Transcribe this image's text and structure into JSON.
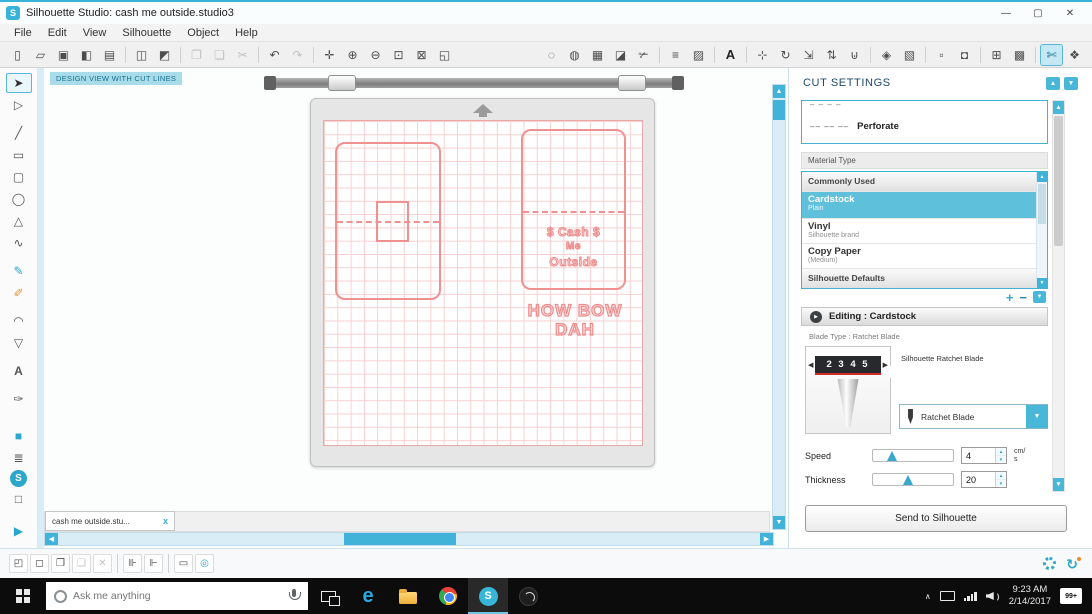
{
  "window": {
    "title": "Silhouette Studio: cash me outside.studio3",
    "app_icon_letter": "S",
    "minimize": "—",
    "maximize": "▢",
    "close": "✕"
  },
  "menu": [
    "File",
    "Edit",
    "View",
    "Silhouette",
    "Object",
    "Help"
  ],
  "icons": {
    "up": "▲",
    "down": "▼",
    "left": "◀",
    "right": "▶",
    "tiny_up": "▴",
    "tiny_down": "▾",
    "plus": "+",
    "minus": "−",
    "play": "▶",
    "chevron_up": "∧",
    "sync": "↻",
    "edge_letter": "e",
    "silhouette_letter": "S"
  },
  "toolbar_left": [
    {
      "name": "new-document-icon",
      "glyph": "▯"
    },
    {
      "name": "open-icon",
      "glyph": "▱"
    },
    {
      "name": "save-icon",
      "glyph": "▣"
    },
    {
      "name": "save-to-library-icon",
      "glyph": "◧"
    },
    {
      "name": "print-icon",
      "glyph": "▤"
    },
    {
      "name": "sep-1",
      "glyph": "",
      "state": "sep",
      "inter": "false"
    },
    {
      "name": "cut-preview-icon",
      "glyph": "◫"
    },
    {
      "name": "send-to-printer-icon",
      "glyph": "◩"
    },
    {
      "name": "sep-2",
      "glyph": "",
      "state": "sep",
      "inter": "false"
    },
    {
      "name": "copy-icon",
      "glyph": "❐",
      "state": "disabled"
    },
    {
      "name": "paste-icon",
      "glyph": "❏",
      "state": "disabled"
    },
    {
      "name": "cut-icon",
      "glyph": "✂",
      "state": "disabled"
    },
    {
      "name": "sep-3",
      "glyph": "",
      "state": "sep",
      "inter": "false"
    },
    {
      "name": "undo-icon",
      "glyph": "↶"
    },
    {
      "name": "redo-icon",
      "glyph": "↷",
      "state": "disabled"
    },
    {
      "name": "sep-4",
      "glyph": "",
      "state": "sep",
      "inter": "false"
    },
    {
      "name": "pan-icon",
      "glyph": "✛"
    },
    {
      "name": "zoom-in-icon",
      "glyph": "⊕"
    },
    {
      "name": "zoom-out-icon",
      "glyph": "⊖"
    },
    {
      "name": "zoom-selection-icon",
      "glyph": "⊡"
    },
    {
      "name": "drag-zoom-icon",
      "glyph": "⊠"
    },
    {
      "name": "fit-to-page-icon",
      "glyph": "◱"
    }
  ],
  "toolbar_right": [
    {
      "name": "lasso-select-icon",
      "glyph": "◌"
    },
    {
      "name": "select-by-color-icon",
      "glyph": "◍"
    },
    {
      "name": "table-icon",
      "glyph": "▦"
    },
    {
      "name": "eraser-icon",
      "glyph": "◪"
    },
    {
      "name": "knife-icon",
      "glyph": "✃"
    },
    {
      "name": "sep-5",
      "glyph": "",
      "state": "sep",
      "inter": "false"
    },
    {
      "name": "line-style-icon",
      "glyph": "≡"
    },
    {
      "name": "fill-style-icon",
      "glyph": "▨"
    },
    {
      "name": "sep-6",
      "glyph": "",
      "state": "sep",
      "inter": "false"
    },
    {
      "name": "text-style-icon",
      "glyph": "A"
    },
    {
      "name": "sep-7",
      "glyph": "",
      "state": "sep",
      "inter": "false"
    },
    {
      "name": "align-icon",
      "glyph": "⊹"
    },
    {
      "name": "rotate-icon",
      "glyph": "↻"
    },
    {
      "name": "scale-icon",
      "glyph": "⇲"
    },
    {
      "name": "spacing-icon",
      "glyph": "⇅"
    },
    {
      "name": "weld-icon",
      "glyph": "⊍"
    },
    {
      "name": "sep-8",
      "glyph": "",
      "state": "sep",
      "inter": "false"
    },
    {
      "name": "trace-icon",
      "glyph": "◈"
    },
    {
      "name": "image-effects-icon",
      "glyph": "▧"
    },
    {
      "name": "sep-9",
      "glyph": "",
      "state": "sep",
      "inter": "false"
    },
    {
      "name": "page-setup-icon",
      "glyph": "▫"
    },
    {
      "name": "registration-marks-icon",
      "glyph": "◘"
    },
    {
      "name": "sep-10",
      "glyph": "",
      "state": "sep",
      "inter": "false"
    },
    {
      "name": "grid-settings-icon",
      "glyph": "⊞"
    },
    {
      "name": "pixscan-icon",
      "glyph": "▩"
    },
    {
      "name": "sep-11",
      "glyph": "",
      "state": "sep",
      "inter": "false"
    },
    {
      "name": "cut-settings-icon",
      "glyph": "✄",
      "state": "active"
    },
    {
      "name": "cut-by-color-icon",
      "glyph": "❖"
    }
  ],
  "tools": [
    {
      "name": "select-tool",
      "glyph": "➤",
      "state": "active"
    },
    {
      "name": "point-editing-tool",
      "glyph": "▷"
    },
    {
      "name": "line-tool",
      "glyph": "╱",
      "gap": "1"
    },
    {
      "name": "rectangle-tool",
      "glyph": "▭"
    },
    {
      "name": "rounded-rectangle-tool",
      "glyph": "▢"
    },
    {
      "name": "ellipse-tool",
      "glyph": "◯"
    },
    {
      "name": "polygon-tool",
      "glyph": "△"
    },
    {
      "name": "curve-tool",
      "glyph": "∿"
    },
    {
      "name": "freehand-tool",
      "glyph": "✎",
      "color": "teal",
      "gap": "1"
    },
    {
      "name": "smooth-freehand-tool",
      "glyph": "✐",
      "color": "orange"
    },
    {
      "name": "arc-tool",
      "glyph": "◠",
      "gap": "1"
    },
    {
      "name": "regular-polygon-tool",
      "glyph": "▽"
    },
    {
      "name": "text-tool",
      "glyph": "A",
      "gap": "1"
    },
    {
      "name": "sticky-note-tool",
      "glyph": "✑",
      "gap": "1"
    },
    {
      "name": "fill-color-tool",
      "glyph": "■",
      "color": "teal",
      "gap": "2"
    },
    {
      "name": "library-icon",
      "glyph": "≣"
    },
    {
      "name": "store-icon",
      "glyph": "S",
      "color": "store"
    },
    {
      "name": "blank-swatch",
      "glyph": "□"
    },
    {
      "name": "expand-panel-icon",
      "glyph": "▶",
      "color": "teal",
      "gap": "3"
    }
  ],
  "canvas": {
    "view_label": "DESIGN VIEW WITH CUT LINES",
    "card2_lines": [
      "$ Cash $",
      "Me",
      "Outside"
    ],
    "meme_lines": [
      "HOW BOW",
      "DAH"
    ]
  },
  "doc_tab": {
    "label": "cash me outside.stu...",
    "close_glyph": "x"
  },
  "cut_settings": {
    "title": "CUT SETTINGS",
    "cut_style_partial_dashes": "– – – –",
    "perforate_icon_dashes": "–– –– ––",
    "perforate_label": "Perforate",
    "material_type_label": "Material Type",
    "materials": [
      {
        "name": "Commonly Used",
        "sub": "",
        "state": "header"
      },
      {
        "name": "Cardstock",
        "sub": "Plain",
        "state": "selected"
      },
      {
        "name": "Vinyl",
        "sub": "Silhouette brand",
        "state": "item"
      },
      {
        "name": "Copy Paper",
        "sub": "(Medium)",
        "state": "item"
      },
      {
        "name": "Silhouette Defaults",
        "sub": "",
        "state": "header"
      }
    ],
    "editing_label": "Editing : Cardstock",
    "blade_type_label": "Blade Type : Ratchet Blade",
    "blade_scale_numbers": "2 3 4 5",
    "blade_title": "Silhouette Ratchet Blade",
    "blade_dropdown_value": "Ratchet Blade",
    "speed_label": "Speed",
    "speed_value": "4",
    "speed_unit_line1": "cm/",
    "speed_unit_line2": "s",
    "thickness_label": "Thickness",
    "thickness_value": "20",
    "send_button_label": "Send to Silhouette"
  },
  "bottom_toolbar": [
    {
      "name": "select-all-icon",
      "glyph": "◰"
    },
    {
      "name": "deselect-icon",
      "glyph": "◻"
    },
    {
      "name": "group-icon",
      "glyph": "❐"
    },
    {
      "name": "ungroup-icon",
      "glyph": "❏",
      "state": "disabled"
    },
    {
      "name": "delete-icon",
      "glyph": "✕",
      "state": "disabled"
    },
    {
      "name": "sep-12",
      "glyph": "",
      "state": "sep",
      "inter": "false"
    },
    {
      "name": "replicate-icon",
      "glyph": "⊪"
    },
    {
      "name": "mirror-icon",
      "glyph": "⊩"
    },
    {
      "name": "sep-13",
      "glyph": "",
      "state": "sep",
      "inter": "false"
    },
    {
      "name": "modify-icon",
      "glyph": "▭"
    },
    {
      "name": "offset-icon",
      "glyph": "◎",
      "color": "teal"
    }
  ],
  "taskbar": {
    "search_placeholder": "Ask me anything",
    "time": "9:23 AM",
    "date": "2/14/2017",
    "notification_count": "99+"
  },
  "colors": {
    "accent_teal": "#41b3d9",
    "material_selected": "#5fc0dc",
    "design_red": "#ef9191",
    "taskbar": "#0c0c0c"
  }
}
